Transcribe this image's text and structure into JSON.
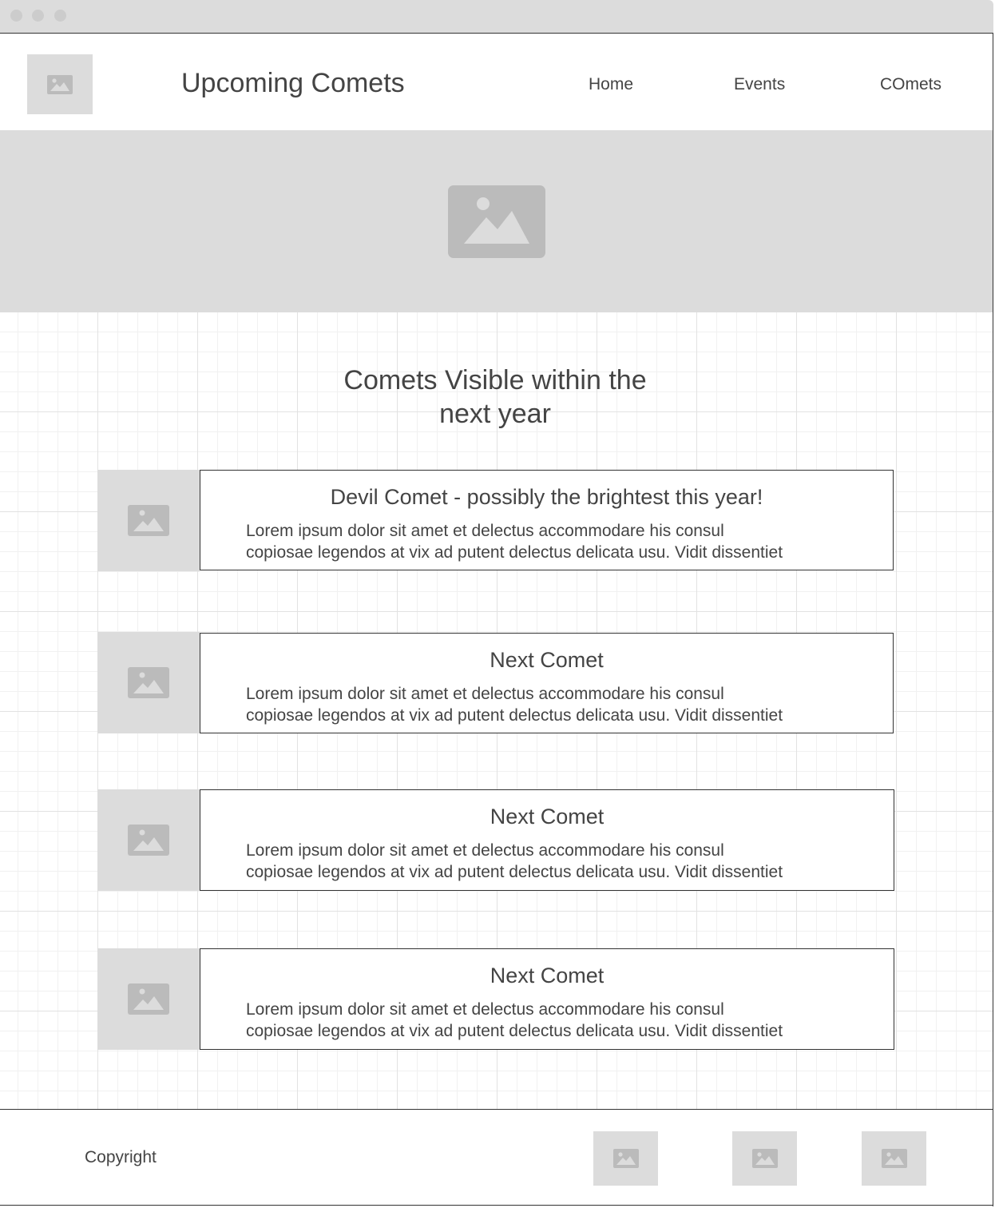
{
  "colors": {
    "placeholder_bg": "#dcdcdc",
    "placeholder_icon": "#bbbbbb",
    "text": "#444444",
    "border": "#333333"
  },
  "header": {
    "logo_icon": "image-placeholder-icon",
    "title": "Upcoming Comets",
    "nav": [
      {
        "label": "Home"
      },
      {
        "label": "Events"
      },
      {
        "label": "COmets"
      }
    ]
  },
  "hero": {
    "icon": "image-placeholder-icon"
  },
  "main": {
    "section_title_line1": "Comets Visible within the",
    "section_title_line2": "next year",
    "cards": [
      {
        "title": "Devil Comet - possibly the brightest this year!",
        "body_line1": "Lorem ipsum dolor sit amet et delectus accommodare his consul",
        "body_line2": "copiosae legendos at vix ad putent delectus delicata usu. Vidit dissentiet"
      },
      {
        "title": "Next Comet",
        "body_line1": "Lorem ipsum dolor sit amet et delectus accommodare his consul",
        "body_line2": "copiosae legendos at vix ad putent delectus delicata usu. Vidit dissentiet"
      },
      {
        "title": "Next Comet",
        "body_line1": "Lorem ipsum dolor sit amet et delectus accommodare his consul",
        "body_line2": "copiosae legendos at vix ad putent delectus delicata usu. Vidit dissentiet"
      },
      {
        "title": "Next Comet",
        "body_line1": "Lorem ipsum dolor sit amet et delectus accommodare his consul",
        "body_line2": "copiosae legendos at vix ad putent delectus delicata usu. Vidit dissentiet"
      }
    ]
  },
  "footer": {
    "copyright": "Copyright",
    "social_icons": [
      "image-placeholder-icon",
      "image-placeholder-icon",
      "image-placeholder-icon"
    ]
  }
}
